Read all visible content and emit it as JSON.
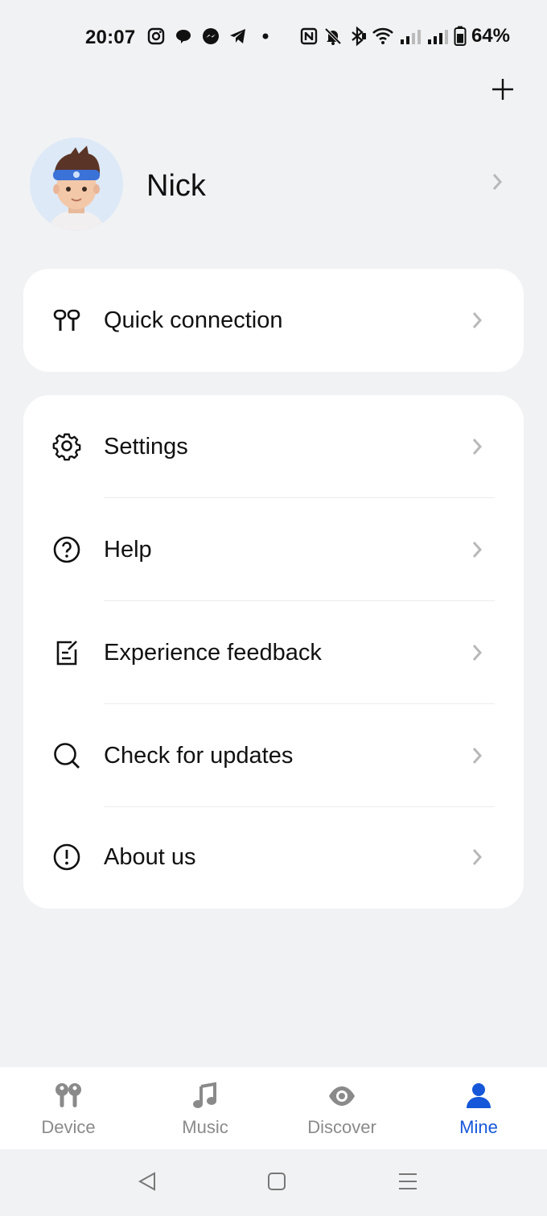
{
  "status_bar": {
    "time": "20:07",
    "app_icons": [
      "instagram-icon",
      "chat-bubble-icon",
      "messenger-icon",
      "telegram-icon",
      "dot-icon"
    ],
    "system_icons": [
      "nfc-icon",
      "mute-icon",
      "bluetooth-icon",
      "wifi-icon",
      "signal-icon",
      "signal-icon",
      "battery-icon"
    ],
    "battery": "64%"
  },
  "header": {
    "add_icon": "plus-icon"
  },
  "profile": {
    "name": "Nick",
    "avatar": "avatar-image"
  },
  "quick_connection": {
    "label": "Quick connection",
    "icon": "earbuds-icon"
  },
  "menu": {
    "items": [
      {
        "label": "Settings",
        "icon": "gear-icon"
      },
      {
        "label": "Help",
        "icon": "question-circle-icon"
      },
      {
        "label": "Experience feedback",
        "icon": "edit-note-icon"
      },
      {
        "label": "Check for updates",
        "icon": "search-icon"
      },
      {
        "label": "About us",
        "icon": "info-exclamation-icon"
      }
    ]
  },
  "bottom_nav": {
    "items": [
      {
        "label": "Device",
        "icon": "earbuds-icon"
      },
      {
        "label": "Music",
        "icon": "music-note-icon"
      },
      {
        "label": "Discover",
        "icon": "eye-icon"
      },
      {
        "label": "Mine",
        "icon": "person-icon"
      }
    ],
    "active": "Mine"
  },
  "colors": {
    "accent": "#1657d9",
    "background": "#f1f2f4",
    "inactive": "#8a8a8a"
  }
}
